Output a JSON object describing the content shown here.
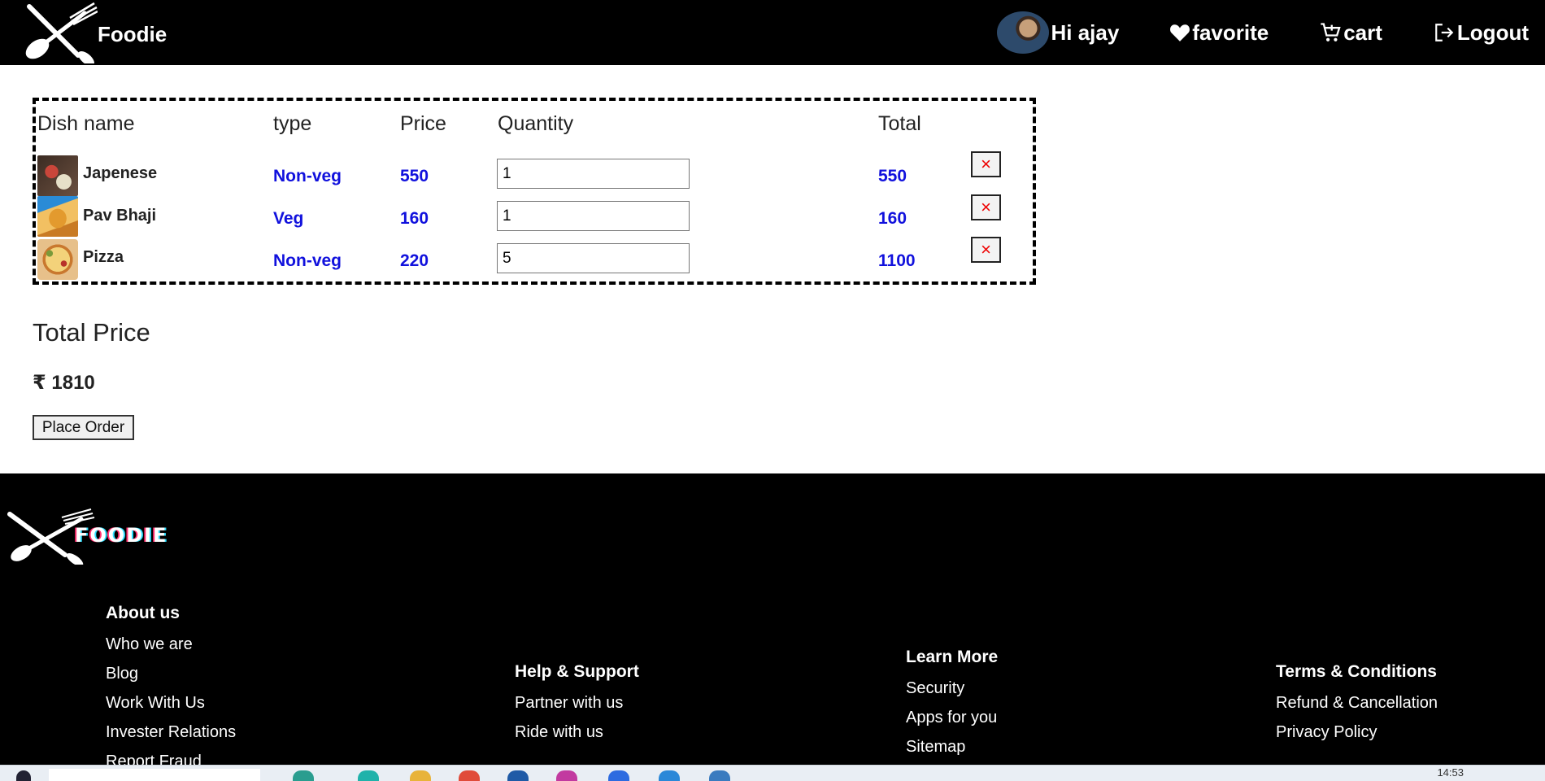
{
  "header": {
    "brand": "Foodie",
    "greeting": "Hi ajay",
    "favorite": "favorite",
    "cart": "cart",
    "logout": "Logout"
  },
  "cart": {
    "columns": {
      "dish": "Dish name",
      "type": "type",
      "price": "Price",
      "quantity": "Quantity",
      "total": "Total"
    },
    "items": [
      {
        "name": "Japenese",
        "type": "Non-veg",
        "price": "550",
        "quantity": "1",
        "total": "550",
        "remove": "×"
      },
      {
        "name": "Pav Bhaji",
        "type": "Veg",
        "price": "160",
        "quantity": "1",
        "total": "160",
        "remove": "×"
      },
      {
        "name": "Pizza",
        "type": "Non-veg",
        "price": "220",
        "quantity": "5",
        "total": "1100",
        "remove": "×"
      }
    ]
  },
  "summary": {
    "label": "Total Price",
    "amount": "₹ 1810",
    "place_order": "Place Order"
  },
  "footer": {
    "brand": "FOODIE",
    "about": {
      "heading": "About us",
      "links": [
        "Who we are",
        "Blog",
        "Work With Us",
        "Invester Relations",
        "Report Fraud"
      ]
    },
    "help": {
      "heading": "Help & Support",
      "links": [
        "Partner with us",
        "Ride with us"
      ]
    },
    "learn": {
      "heading": "Learn More",
      "links": [
        "Security",
        "Apps for you",
        "Sitemap"
      ]
    },
    "terms": {
      "heading": "Terms & Conditions",
      "links": [
        "Refund & Cancellation",
        "Privacy Policy"
      ]
    }
  },
  "taskbar": {
    "time": "14:53"
  },
  "colors": {
    "accent_blue": "#1111dd",
    "remove_red": "#ee0000",
    "header_bg": "#000000"
  }
}
